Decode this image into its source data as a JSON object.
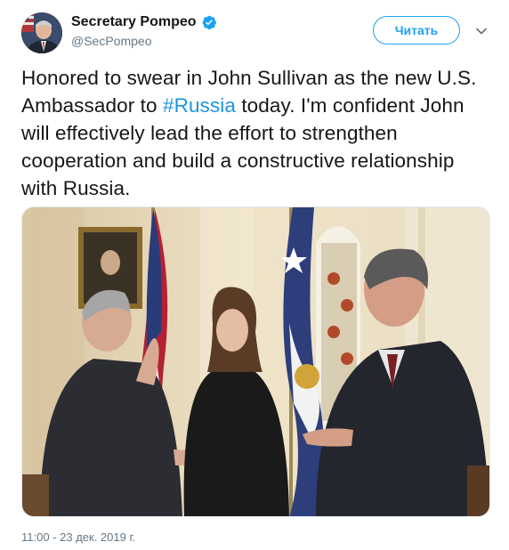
{
  "header": {
    "display_name": "Secretary Pompeo",
    "handle": "@SecPompeo",
    "follow_label": "Читать",
    "verified_icon": "verified-badge-icon",
    "caret_icon": "chevron-down-icon"
  },
  "tweet": {
    "text_before": "Honored to swear in John Sullivan as the new U.S. Ambassador to ",
    "hashtag": "#Russia",
    "text_after": " today. I'm confident John will effectively lead the effort to strengthen cooperation and build a constructive relationship with Russia.",
    "timestamp": "11:00 - 23 дек. 2019 г."
  },
  "colors": {
    "accent": "#1da1f2",
    "hashtag": "#1b95e0",
    "muted": "#657786",
    "text": "#14171a"
  }
}
